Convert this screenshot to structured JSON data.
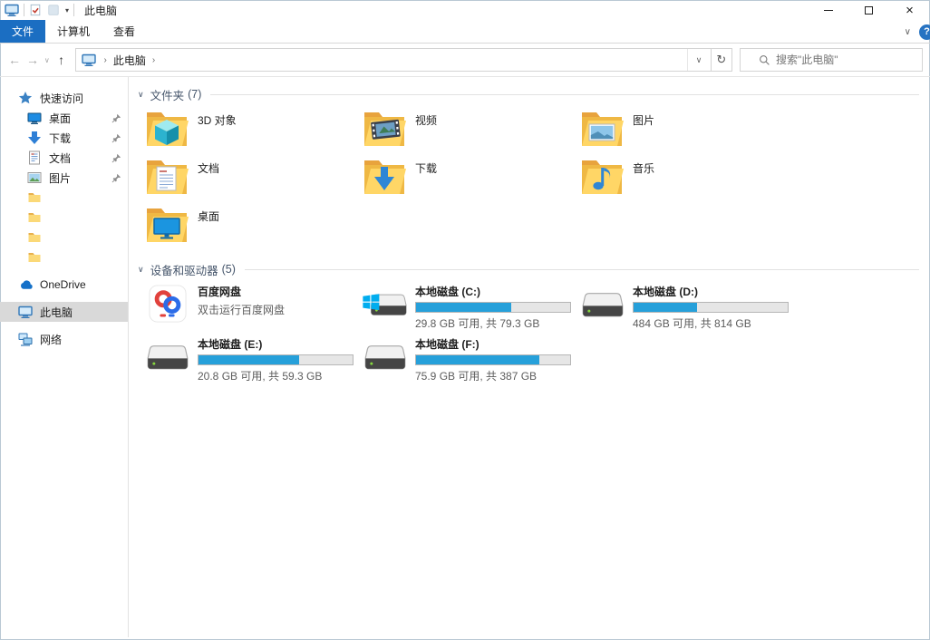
{
  "window": {
    "title": "此电脑"
  },
  "glyphs": {
    "back": "←",
    "forward": "→",
    "up": "↑",
    "refresh": "↻",
    "chevron_down": "∨",
    "breadcrumb_sep": "›",
    "qat_dropdown": "▾",
    "close": "×",
    "help": "?"
  },
  "colors": {
    "accent": "#1b6ec2",
    "drive_fill": "#26a0da",
    "selection": "#d9d9d9"
  },
  "ribbon": {
    "tabs": [
      {
        "label": "文件",
        "active": true
      },
      {
        "label": "计算机",
        "active": false
      },
      {
        "label": "查看",
        "active": false
      }
    ]
  },
  "navbar": {
    "breadcrumb": "此电脑",
    "search_placeholder": "搜索\"此电脑\""
  },
  "sidebar": {
    "items": [
      {
        "icon": "star",
        "label": "快速访问"
      },
      {
        "icon": "desktop-blue",
        "label": "桌面",
        "pinned": true,
        "indent": true
      },
      {
        "icon": "download-arrow",
        "label": "下载",
        "pinned": true,
        "indent": true
      },
      {
        "icon": "document",
        "label": "文档",
        "pinned": true,
        "indent": true
      },
      {
        "icon": "pictures",
        "label": "图片",
        "pinned": true,
        "indent": true
      },
      {
        "icon": "folder",
        "label": "",
        "indent": true
      },
      {
        "icon": "folder",
        "label": "",
        "indent": true
      },
      {
        "icon": "folder",
        "label": "",
        "indent": true
      },
      {
        "icon": "folder",
        "label": "",
        "indent": true
      },
      {
        "icon": "onedrive",
        "label": "OneDrive",
        "gap": true
      },
      {
        "icon": "thispc",
        "label": "此电脑",
        "selected": true,
        "gap": true
      },
      {
        "icon": "network",
        "label": "网络",
        "gap": true
      }
    ]
  },
  "main": {
    "sections": [
      {
        "title": "文件夹",
        "count": "(7)",
        "items": [
          {
            "icon": "folder-3d",
            "label": "3D 对象"
          },
          {
            "icon": "folder-video",
            "label": "视频"
          },
          {
            "icon": "folder-pictures",
            "label": "图片"
          },
          {
            "icon": "folder-docs",
            "label": "文档"
          },
          {
            "icon": "folder-download",
            "label": "下载"
          },
          {
            "icon": "folder-music",
            "label": "音乐"
          },
          {
            "icon": "folder-desktop",
            "label": "桌面"
          }
        ]
      },
      {
        "title": "设备和驱动器",
        "count": "(5)",
        "items": [
          {
            "icon": "baidu",
            "label": "百度网盘",
            "subtitle": "双击运行百度网盘",
            "square": true
          },
          {
            "icon": "drive-windows",
            "label": "本地磁盘 (C:)",
            "capacity": "29.8 GB 可用, 共 79.3 GB",
            "percent": 62
          },
          {
            "icon": "drive",
            "label": "本地磁盘 (D:)",
            "capacity": "484 GB 可用, 共 814 GB",
            "percent": 41
          },
          {
            "icon": "drive",
            "label": "本地磁盘 (E:)",
            "capacity": "20.8 GB 可用, 共 59.3 GB",
            "percent": 65
          },
          {
            "icon": "drive",
            "label": "本地磁盘 (F:)",
            "capacity": "75.9 GB 可用, 共 387 GB",
            "percent": 80
          }
        ]
      }
    ]
  }
}
